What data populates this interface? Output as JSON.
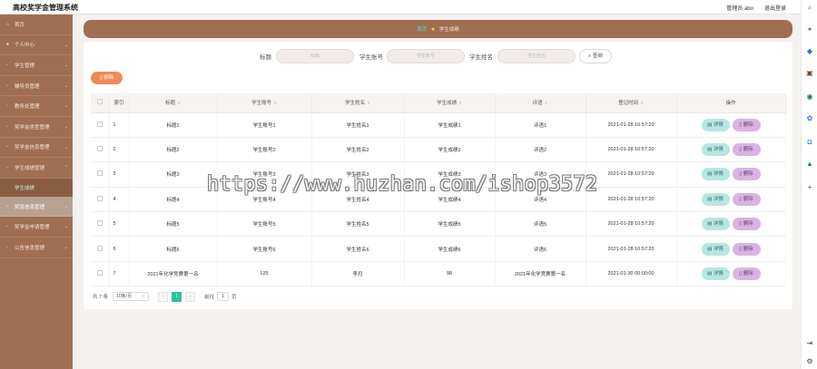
{
  "app": {
    "title": "高校奖学金管理系统",
    "user_label": "管理员 abo",
    "logout_label": "退出登录"
  },
  "sidebar": {
    "items": [
      {
        "label": "首页",
        "icon": "home-icon"
      },
      {
        "label": "个人中心",
        "icon": "user-icon"
      },
      {
        "label": "学生管理",
        "icon": "folder-icon"
      },
      {
        "label": "辅导员管理",
        "icon": "folder-icon"
      },
      {
        "label": "教务处管理",
        "icon": "folder-icon"
      },
      {
        "label": "奖学金类型管理",
        "icon": "folder-icon"
      },
      {
        "label": "奖学金信息管理",
        "icon": "folder-icon"
      },
      {
        "label": "学生成绩管理",
        "icon": "folder-icon"
      }
    ],
    "sub_item": "学生成绩",
    "items_after": [
      {
        "label": "奖惩信息管理",
        "icon": "folder-icon"
      },
      {
        "label": "奖学金申请管理",
        "icon": "folder-icon"
      },
      {
        "label": "公告信息管理",
        "icon": "folder-icon"
      }
    ]
  },
  "breadcrumb": {
    "home": "首页",
    "current": "学生成绩"
  },
  "search": {
    "title_label": "标题",
    "title_placeholder": "标题",
    "account_label": "学生账号",
    "account_placeholder": "学生账号",
    "name_label": "学生姓名",
    "name_placeholder": "学生姓名",
    "query_button": "查询"
  },
  "toolbar": {
    "delete_label": "删除"
  },
  "table": {
    "headers": {
      "index": "索引",
      "title": "标题",
      "account": "学生账号",
      "name": "学生姓名",
      "score": "学生成绩",
      "comment": "评语",
      "time": "登记时间",
      "ops": "操作"
    },
    "detail_label": "详情",
    "delete_label": "删除",
    "rows": [
      {
        "index": "1",
        "title": "标题1",
        "account": "学生账号1",
        "name": "学生姓名1",
        "score": "学生成绩1",
        "comment": "评语1",
        "time": "2021-01-28 10:57:20"
      },
      {
        "index": "2",
        "title": "标题2",
        "account": "学生账号2",
        "name": "学生姓名2",
        "score": "学生成绩2",
        "comment": "评语2",
        "time": "2021-01-28 10:57:20"
      },
      {
        "index": "3",
        "title": "标题3",
        "account": "学生账号3",
        "name": "学生姓名3",
        "score": "学生成绩3",
        "comment": "评语3",
        "time": "2021-01-28 10:57:20"
      },
      {
        "index": "4",
        "title": "标题4",
        "account": "学生账号4",
        "name": "学生姓名4",
        "score": "学生成绩4",
        "comment": "评语4",
        "time": "2021-01-28 10:57:20"
      },
      {
        "index": "5",
        "title": "标题5",
        "account": "学生账号5",
        "name": "学生姓名5",
        "score": "学生成绩5",
        "comment": "评语5",
        "time": "2021-01-28 10:57:20"
      },
      {
        "index": "6",
        "title": "标题6",
        "account": "学生账号6",
        "name": "学生姓名6",
        "score": "学生成绩6",
        "comment": "评语6",
        "time": "2021-01-28 10:57:20"
      },
      {
        "index": "7",
        "title": "2021年化学竞赛第一名",
        "account": "125",
        "name": "李月",
        "score": "98",
        "comment": "2021年化学竞赛第一名",
        "time": "2021-01-30 00:00:00"
      }
    ]
  },
  "pager": {
    "total": "共 7 条",
    "page_size": "10条/页",
    "prev": "‹",
    "current_page": "1",
    "next": "›",
    "goto_label": "前往",
    "goto_value": "1",
    "page_unit": "页"
  },
  "watermark": "https://www.huzhan.com/ishop3572",
  "colors": {
    "sidebar": "#a06e52",
    "accent": "#2ec0a0",
    "delete_top": "#f08a58",
    "detail": "#b7e6e1",
    "delete_row": "#d9b4e3"
  }
}
